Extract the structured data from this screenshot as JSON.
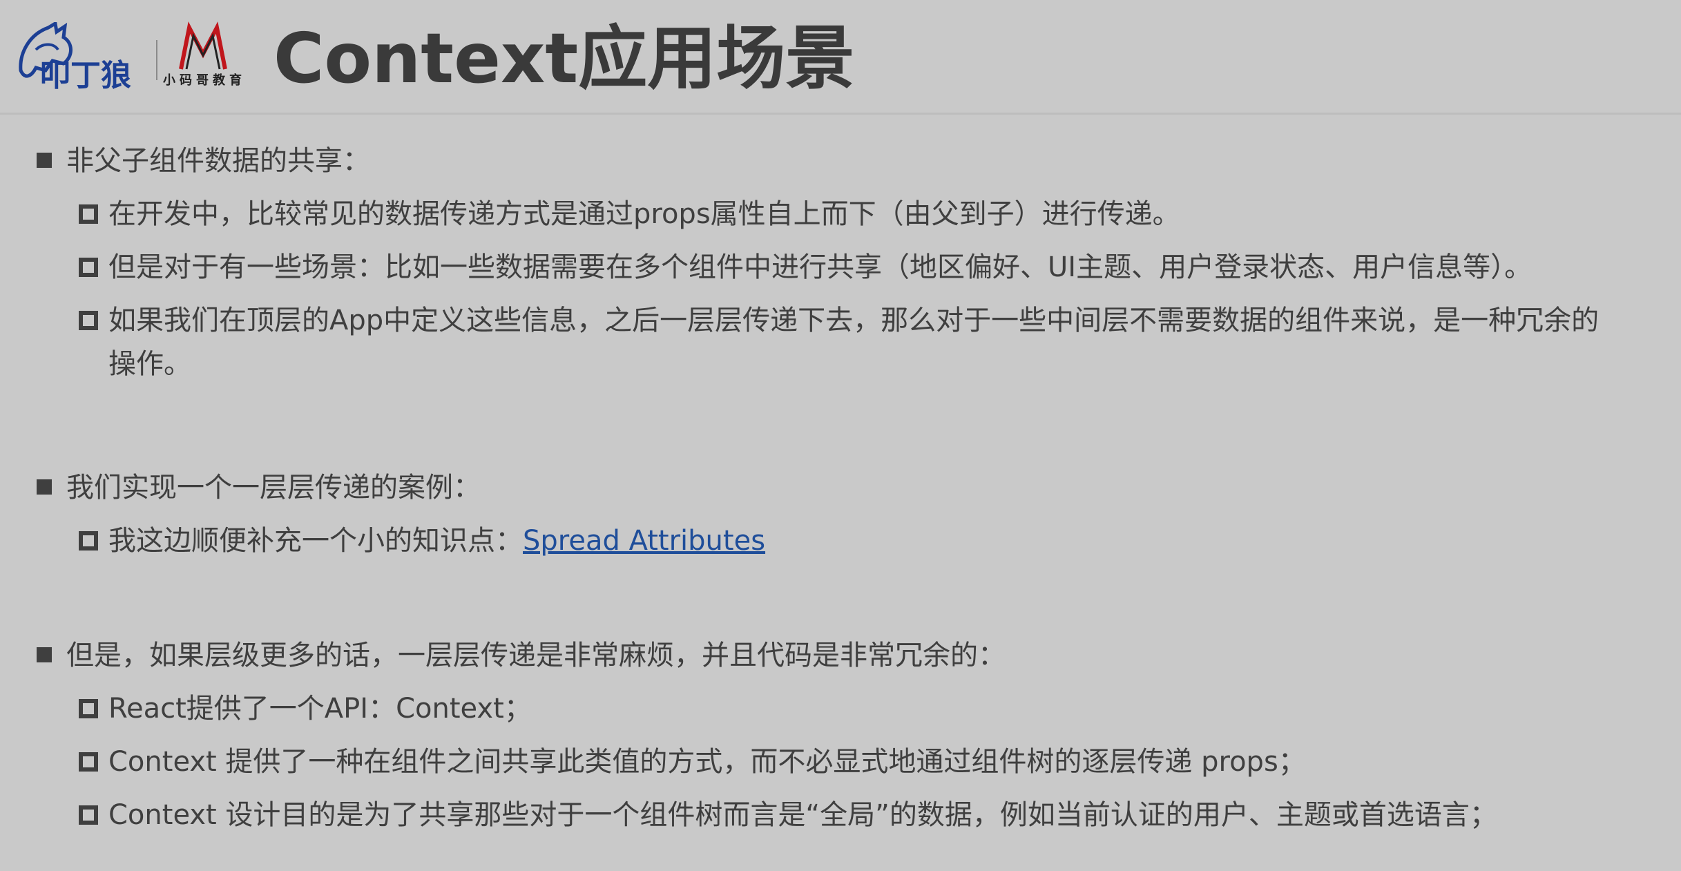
{
  "header": {
    "title": "Context应用场景",
    "logo_brand_text": "小码哥教育",
    "logo_wolf_text": "叩丁狼"
  },
  "sections": [
    {
      "heading": "非父子组件数据的共享：",
      "items": [
        "在开发中，比较常见的数据传递方式是通过props属性自上而下（由父到子）进行传递。",
        "但是对于有一些场景：比如一些数据需要在多个组件中进行共享（地区偏好、UI主题、用户登录状态、用户信息等）。",
        "如果我们在顶层的App中定义这些信息，之后一层层传递下去，那么对于一些中间层不需要数据的组件来说，是一种冗余的",
        "操作。"
      ]
    },
    {
      "heading": "我们实现一个一层层传递的案例：",
      "items": [
        "我这边顺便补充一个小的知识点："
      ],
      "link_text": "Spread Attributes"
    },
    {
      "heading": "但是，如果层级更多的话，一层层传递是非常麻烦，并且代码是非常冗余的：",
      "items": [
        "React提供了一个API：Context；",
        "Context 提供了一种在组件之间共享此类值的方式，而不必显式地通过组件树的逐层传递 props；",
        "Context 设计目的是为了共享那些对于一个组件树而言是“全局”的数据，例如当前认证的用户、主题或首选语言；"
      ]
    }
  ],
  "colors": {
    "background": "#c9c9c9",
    "text": "#3f3f3f",
    "link": "#1f4e9a",
    "logo_blue": "#1c3f94",
    "logo_red": "#c0161c"
  }
}
